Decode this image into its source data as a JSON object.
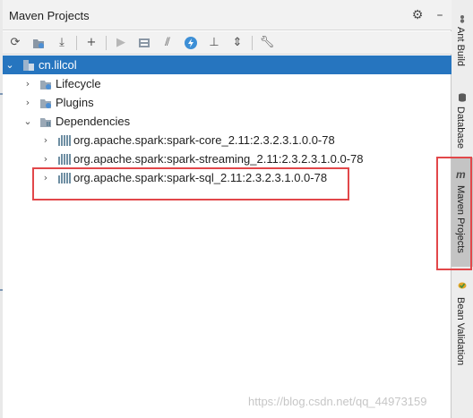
{
  "panel": {
    "title": "Maven Projects",
    "header_icons": [
      "gear-icon",
      "minimize-icon"
    ],
    "toolbar_icons": [
      "reimport-icon",
      "generate-sources-icon",
      "download-icon",
      "add-icon",
      "run-icon",
      "execute-goal-icon",
      "skip-tests-icon",
      "lightning-icon",
      "show-dependencies-icon",
      "collapse-all-icon",
      "settings-wrench-icon"
    ]
  },
  "tree": {
    "root": {
      "label": "cn.lilcol"
    },
    "lifecycle": {
      "label": "Lifecycle"
    },
    "plugins": {
      "label": "Plugins"
    },
    "dependencies": {
      "label": "Dependencies",
      "items": [
        {
          "label": "org.apache.spark:spark-core_2.11:2.3.2.3.1.0.0-78"
        },
        {
          "label": "org.apache.spark:spark-streaming_2.11:2.3.2.3.1.0.0-78"
        },
        {
          "label": "org.apache.spark:spark-sql_2.11:2.3.2.3.1.0.0-78"
        }
      ]
    }
  },
  "side_tabs": [
    {
      "label": "Ant Build",
      "icon": "ant-icon"
    },
    {
      "label": "Database",
      "icon": "database-icon"
    },
    {
      "label": "Maven Projects",
      "icon": "maven-icon",
      "active": true
    },
    {
      "label": "Bean Validation",
      "icon": "bean-icon"
    }
  ],
  "watermark": "https://blog.csdn.net/qq_44973159",
  "colors": {
    "selection": "#2675bf",
    "annotation_box": "#e2474a",
    "panel_header_bg": "#f2f2f2"
  }
}
